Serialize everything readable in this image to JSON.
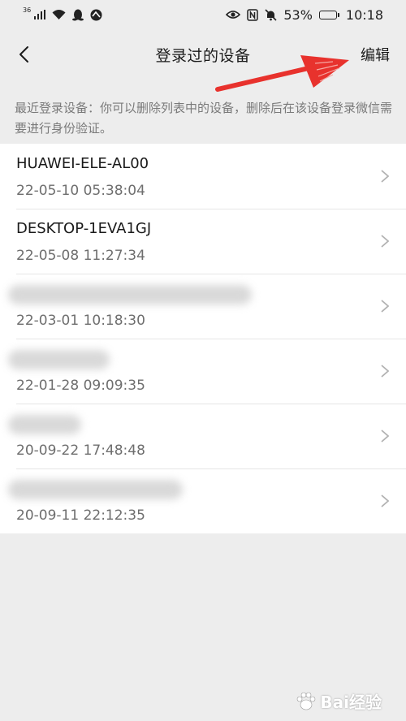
{
  "status_bar": {
    "network": "36",
    "battery_percent": "53%",
    "battery_level": 0.53,
    "time": "10:18"
  },
  "nav": {
    "title": "登录过的设备",
    "edit_label": "编辑"
  },
  "intro": "最近登录设备：你可以删除列表中的设备，删除后在该设备登录微信需要进行身份验证。",
  "devices": [
    {
      "name": "HUAWEI-ELE-AL00",
      "time": "22-05-10 05:38:04"
    },
    {
      "name": "DESKTOP-1EVA1GJ",
      "time": "22-05-08 11:27:34"
    },
    {
      "name": "",
      "time": "22-03-01 10:18:30"
    },
    {
      "name": "",
      "time": "22-01-28 09:09:35"
    },
    {
      "name": "",
      "time": "20-09-22 17:48:48"
    },
    {
      "name": "",
      "time": "20-09-11 22:12:35"
    }
  ],
  "colors": {
    "background": "#ededed",
    "annotation_arrow": "#e8322d",
    "list_background": "#ffffff"
  },
  "watermark": {
    "text": "Bai经验",
    "icon": "baidu-paw-icon"
  }
}
